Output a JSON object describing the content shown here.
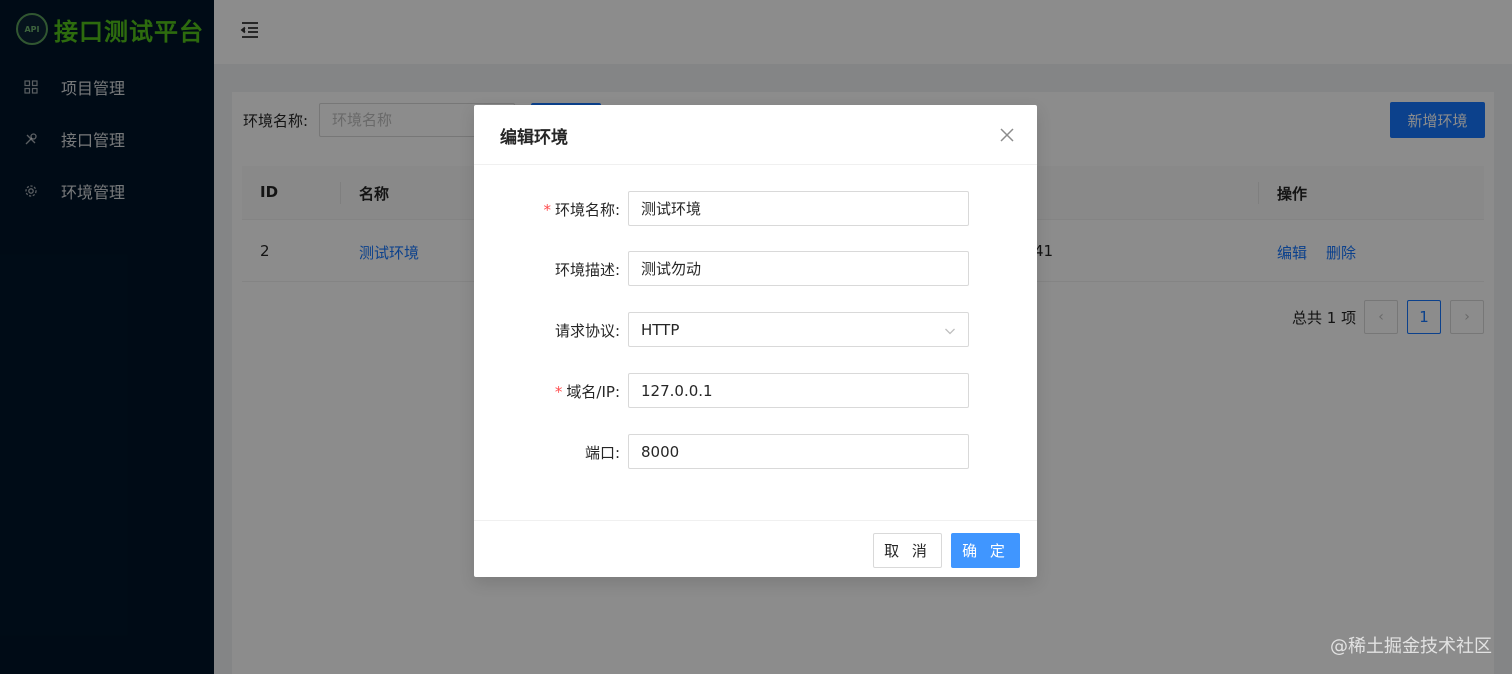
{
  "app": {
    "logo_badge": "API",
    "title": "接口测试平台"
  },
  "sidebar": {
    "items": [
      {
        "label": "项目管理",
        "icon": "grid-icon"
      },
      {
        "label": "接口管理",
        "icon": "tools-icon"
      },
      {
        "label": "环境管理",
        "icon": "gear-icon"
      }
    ]
  },
  "toolbar": {
    "search_label": "环境名称:",
    "search_placeholder": "环境名称",
    "add_label": "新增环境"
  },
  "table": {
    "headers": [
      "ID",
      "名称",
      "操作"
    ],
    "rows": [
      {
        "id": "2",
        "name": "测试环境",
        "partial": "41",
        "edit": "编辑",
        "delete": "删除"
      }
    ]
  },
  "pagination": {
    "total": "总共 1 项",
    "current": "1",
    "prev": "‹",
    "next": "›"
  },
  "modal": {
    "title": "编辑环境",
    "fields": {
      "name": {
        "label": "环境名称:",
        "value": "测试环境",
        "required": "*"
      },
      "desc": {
        "label": "环境描述:",
        "value": "测试勿动"
      },
      "protocol": {
        "label": "请求协议:",
        "value": "HTTP"
      },
      "host": {
        "label": "域名/IP:",
        "value": "127.0.0.1",
        "required": "*"
      },
      "port": {
        "label": "端口:",
        "value": "8000"
      }
    },
    "cancel": "取 消",
    "ok": "确 定"
  },
  "watermark": "@稀土掘金技术社区",
  "colors": {
    "primary": "#1677ff",
    "sidebar": "#001529",
    "logo": "#52c41a",
    "required": "#ff4d4f"
  }
}
